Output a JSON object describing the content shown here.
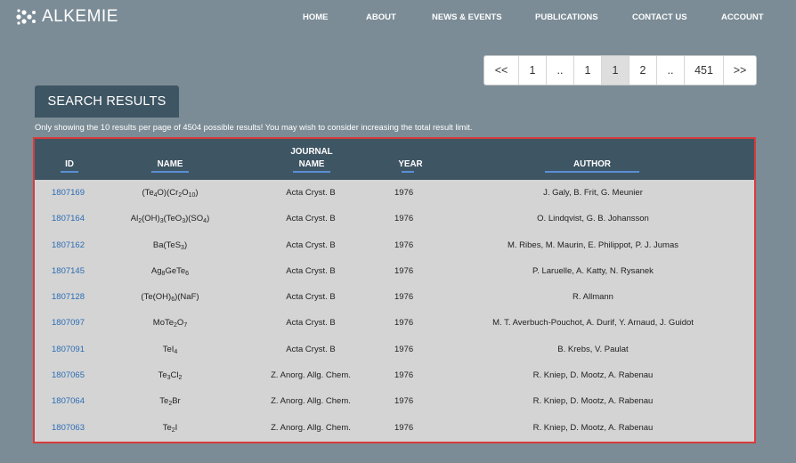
{
  "brand": {
    "name": "ALKEMIE",
    "icon": "molecule-logo-icon"
  },
  "nav": [
    "HOME",
    "ABOUT",
    "NEWS & EVENTS",
    "PUBLICATIONS",
    "CONTACT US",
    "ACCOUNT"
  ],
  "pagination": {
    "pages": [
      "<<",
      "1",
      "..",
      "1",
      "1",
      "2",
      "..",
      "451",
      ">>"
    ],
    "active_index": 4
  },
  "results": {
    "tab_label": "SEARCH RESULTS",
    "notice": "Only showing the 10 results per page of 4504 possible results! You may wish to consider increasing the total result limit."
  },
  "table": {
    "columns": [
      {
        "key": "id",
        "label": "ID"
      },
      {
        "key": "name",
        "label": "NAME"
      },
      {
        "key": "journal",
        "label_line1": "JOURNAL",
        "label_line2": "NAME"
      },
      {
        "key": "year",
        "label": "YEAR"
      },
      {
        "key": "author",
        "label": "AUTHOR"
      }
    ],
    "rows": [
      {
        "id": "1807169",
        "name_parts": [
          [
            "(Te",
            ""
          ],
          [
            "4",
            "sub"
          ],
          [
            "O)(Cr",
            ""
          ],
          [
            "2",
            "sub"
          ],
          [
            "O",
            ""
          ],
          [
            "10",
            "sub"
          ],
          [
            ")",
            ""
          ]
        ],
        "journal": "Acta Cryst. B",
        "year": "1976",
        "author": "J. Galy, B. Frit, G. Meunier"
      },
      {
        "id": "1807164",
        "name_parts": [
          [
            "Al",
            ""
          ],
          [
            "2",
            "sub"
          ],
          [
            "(OH)",
            ""
          ],
          [
            "3",
            "sub"
          ],
          [
            "(TeO",
            ""
          ],
          [
            "3",
            "sub"
          ],
          [
            ")(SO",
            ""
          ],
          [
            "4",
            "sub"
          ],
          [
            ")",
            ""
          ]
        ],
        "journal": "Acta Cryst. B",
        "year": "1976",
        "author": "O. Lindqvist, G. B. Johansson"
      },
      {
        "id": "1807162",
        "name_parts": [
          [
            "Ba(TeS",
            ""
          ],
          [
            "3",
            "sub"
          ],
          [
            ")",
            ""
          ]
        ],
        "journal": "Acta Cryst. B",
        "year": "1976",
        "author": "M. Ribes, M. Maurin, E. Philippot, P. J. Jumas"
      },
      {
        "id": "1807145",
        "name_parts": [
          [
            "Ag",
            ""
          ],
          [
            "8",
            "sub"
          ],
          [
            "GeTe",
            ""
          ],
          [
            "6",
            "sub"
          ]
        ],
        "journal": "Acta Cryst. B",
        "year": "1976",
        "author": "P. Laruelle, A. Katty, N. Rysanek"
      },
      {
        "id": "1807128",
        "name_parts": [
          [
            "(Te(OH)",
            ""
          ],
          [
            "6",
            "sub"
          ],
          [
            ")(NaF)",
            ""
          ]
        ],
        "journal": "Acta Cryst. B",
        "year": "1976",
        "author": "R. Allmann"
      },
      {
        "id": "1807097",
        "name_parts": [
          [
            "MoTe",
            ""
          ],
          [
            "2",
            "sub"
          ],
          [
            "O",
            ""
          ],
          [
            "7",
            "sub"
          ]
        ],
        "journal": "Acta Cryst. B",
        "year": "1976",
        "author": "M. T. Averbuch-Pouchot, A. Durif, Y. Arnaud, J. Guidot"
      },
      {
        "id": "1807091",
        "name_parts": [
          [
            "TeI",
            ""
          ],
          [
            "4",
            "sub"
          ]
        ],
        "journal": "Acta Cryst. B",
        "year": "1976",
        "author": "B. Krebs, V. Paulat"
      },
      {
        "id": "1807065",
        "name_parts": [
          [
            "Te",
            ""
          ],
          [
            "3",
            "sub"
          ],
          [
            "Cl",
            ""
          ],
          [
            "2",
            "sub"
          ]
        ],
        "journal": "Z. Anorg. Allg. Chem.",
        "year": "1976",
        "author": "R. Kniep, D. Mootz, A. Rabenau"
      },
      {
        "id": "1807064",
        "name_parts": [
          [
            "Te",
            ""
          ],
          [
            "2",
            "sub"
          ],
          [
            "Br",
            ""
          ]
        ],
        "journal": "Z. Anorg. Allg. Chem.",
        "year": "1976",
        "author": "R. Kniep, D. Mootz, A. Rabenau"
      },
      {
        "id": "1807063",
        "name_parts": [
          [
            "Te",
            ""
          ],
          [
            "2",
            "sub"
          ],
          [
            "I",
            ""
          ]
        ],
        "journal": "Z. Anorg. Allg. Chem.",
        "year": "1976",
        "author": "R. Kniep, D. Mootz, A. Rabenau"
      }
    ]
  },
  "colors": {
    "background": "#7b8c96",
    "header_bar": "#3e5563",
    "table_border": "#d93b3b",
    "table_body": "#d4d4d4",
    "link": "#2b6db4",
    "header_underline": "#5b8fd6"
  }
}
